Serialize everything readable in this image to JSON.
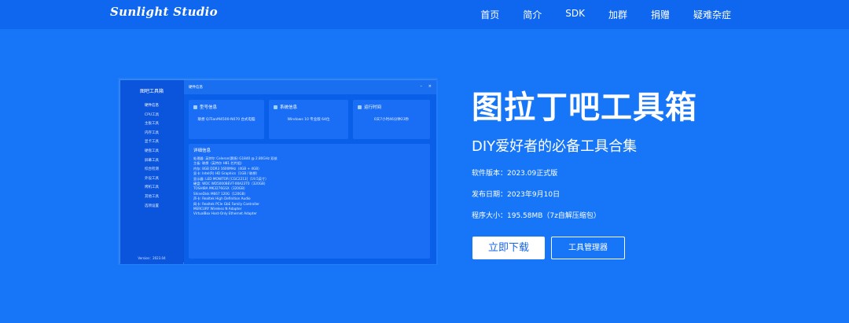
{
  "header": {
    "logo": "Sunlight Studio",
    "nav": [
      "首页",
      "简介",
      "SDK",
      "加群",
      "捐赠",
      "疑难杂症"
    ]
  },
  "preview": {
    "brand": "图吧工具箱",
    "menu": [
      "硬件信息",
      "CPU工具",
      "主板工具",
      "内存工具",
      "显卡工具",
      "硬盘工具",
      "屏幕工具",
      "综合检测",
      "外设工具",
      "烤机工具",
      "其他工具",
      "选项设置"
    ],
    "version": "Version：2023.04",
    "window_title": "硬件信息",
    "window_controls": [
      "–",
      "×"
    ],
    "cards": [
      {
        "title": "型号信息",
        "value": "联想 QiTianM4500-N070 台式电脑"
      },
      {
        "title": "系统信息",
        "value": "Windows 10 专业版 64位"
      },
      {
        "title": "运行时间",
        "value": "0天7小时46分钟23秒"
      }
    ],
    "detail_title": "详细信息",
    "detail_lines": [
      "处理器:    英特尔 Celeron(赛扬) G1840 @ 2.80GHz 双核",
      "主板:       联想（英特尔 H81 芯片组）",
      "内存:       8GB DDR3 1600MHz（4GB + 4GB）",
      "显卡:       Intel(R) HD Graphics（1GB / 联想）",
      "显示器:    LED MONITOR [CGC2213]（19.5英寸）",
      "硬盘:       WDC WD5000BEVT-00A23T0（320GB）",
      "               TOSHIBA MK3276GSX（320GB）",
      "               ShineDisk M667 120G（120GB）",
      "声卡:       Realtek High Definition Audio",
      "网卡:       Realtek PCIe GbE Family Controller",
      "               MERCURY Wireless N Adapter",
      "               VirtualBox Host-Only Ethernet Adapter"
    ]
  },
  "hero": {
    "title": "图拉丁吧工具箱",
    "subtitle": "DIY爱好者的必备工具合集",
    "version_label": "软件版本：2023.09正式版",
    "date_label": "发布日期：2023年9月10日",
    "size_label": "程序大小：195.58MB（7z自解压缩包）",
    "download_button": "立即下载",
    "manager_button": "工具管理器"
  },
  "colors": {
    "background": "#1776f7",
    "topbar": "#0f66ef",
    "primary_button_text": "#1565e8"
  }
}
